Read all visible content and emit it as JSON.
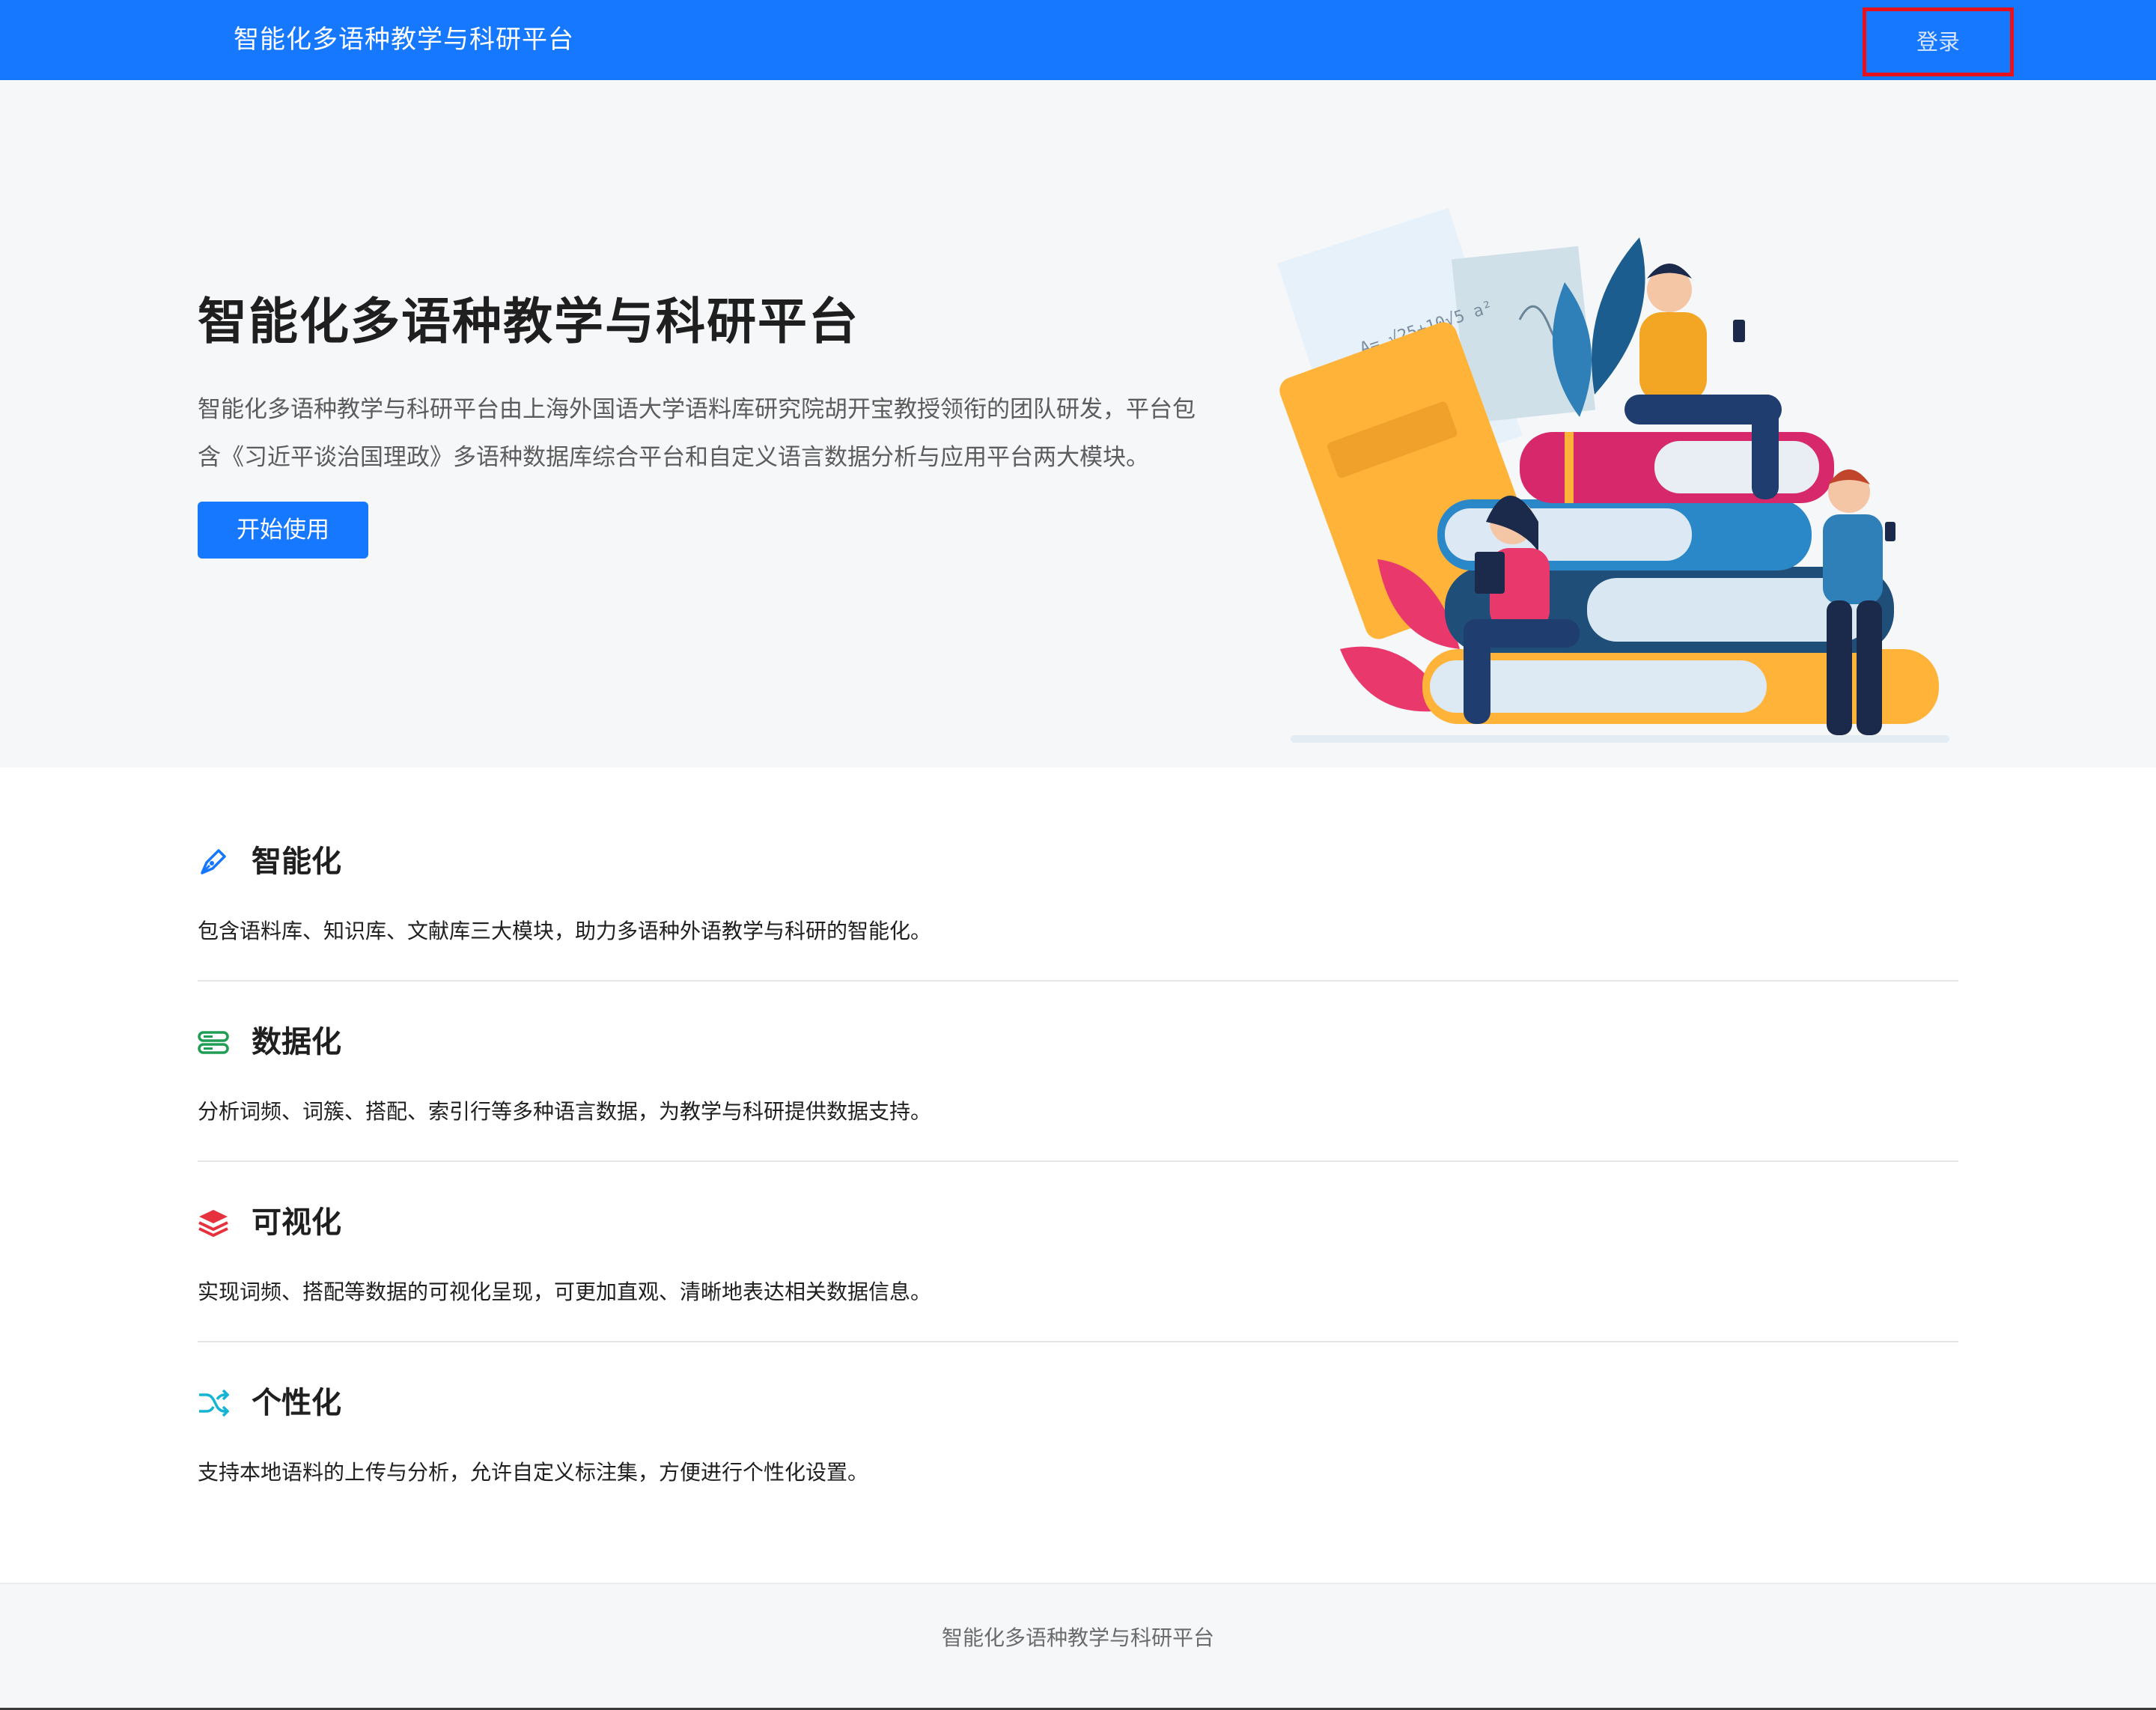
{
  "header": {
    "brand": "智能化多语种教学与科研平台",
    "login_label": "登录"
  },
  "hero": {
    "title": "智能化多语种教学与科研平台",
    "description": "智能化多语种教学与科研平台由上海外国语大学语料库研究院胡开宝教授领衔的团队研发，平台包含《习近平谈治国理政》多语种数据库综合平台和自定义语言数据分析与应用平台两大模块。",
    "start_label": "开始使用",
    "illustration_formula": "A= √25+10√5 a²"
  },
  "features": [
    {
      "icon": "pen-nib-icon",
      "title": "智能化",
      "description": "包含语料库、知识库、文献库三大模块，助力多语种外语教学与科研的智能化。",
      "color": "#1677ff"
    },
    {
      "icon": "database-icon",
      "title": "数据化",
      "description": "分析词频、词簇、搭配、索引行等多种语言数据，为教学与科研提供数据支持。",
      "color": "#1f9d55"
    },
    {
      "icon": "layers-icon",
      "title": "可视化",
      "description": "实现词频、搭配等数据的可视化呈现，可更加直观、清晰地表达相关数据信息。",
      "color": "#e5323e"
    },
    {
      "icon": "shuffle-icon",
      "title": "个性化",
      "description": "支持本地语料的上传与分析，允许自定义标注集，方便进行个性化设置。",
      "color": "#13b4d4"
    }
  ],
  "footer": {
    "text": "智能化多语种教学与科研平台"
  },
  "colors": {
    "primary": "#1677ff",
    "highlight_border": "#e8101a",
    "hero_background": "#f6f7f9"
  }
}
